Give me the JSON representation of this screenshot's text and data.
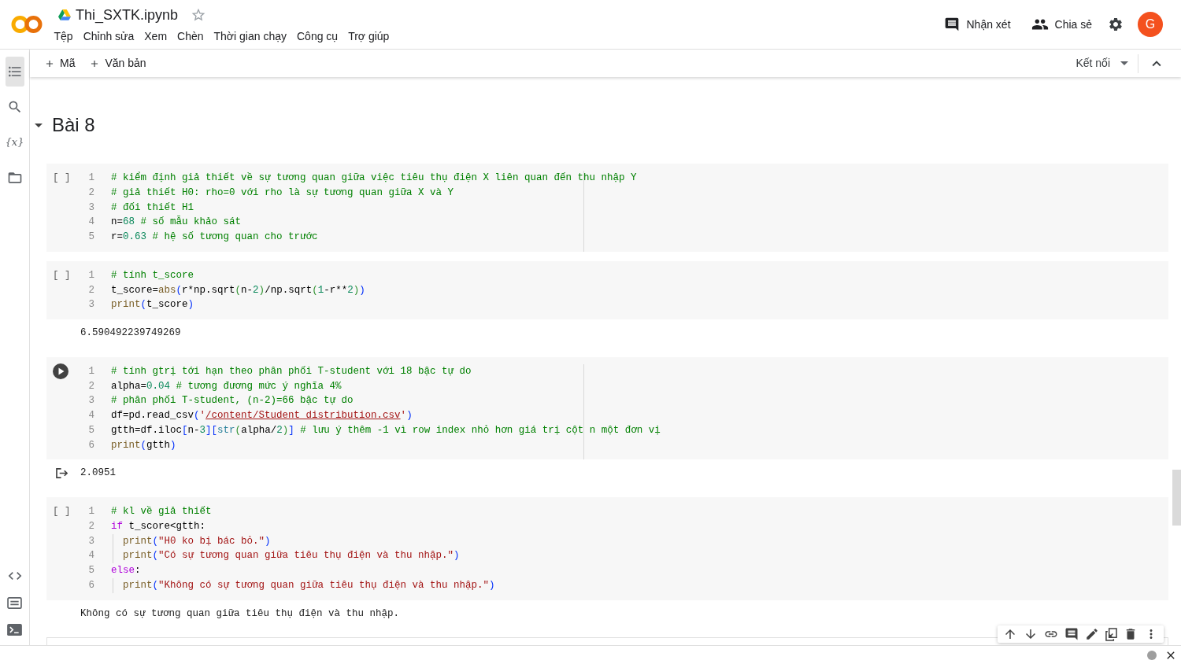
{
  "header": {
    "title": "Thi_SXTK.ipynb",
    "starred": false,
    "menu": [
      "Tệp",
      "Chỉnh sửa",
      "Xem",
      "Chèn",
      "Thời gian chạy",
      "Công cụ",
      "Trợ giúp"
    ],
    "actions": [
      {
        "kind": "comment",
        "label": "Nhận xét"
      },
      {
        "kind": "share",
        "label": "Chia sẻ"
      }
    ],
    "avatar": "G"
  },
  "sidebar": {
    "top": [
      {
        "kind": "toc",
        "selected": true
      },
      {
        "kind": "search",
        "selected": false
      },
      {
        "kind": "variables",
        "glyph": "{x}",
        "selected": false
      },
      {
        "kind": "files",
        "selected": false
      }
    ],
    "bottom": [
      {
        "kind": "snippets",
        "selected": false
      },
      {
        "kind": "palette",
        "selected": false
      },
      {
        "kind": "terminal",
        "selected": false
      }
    ]
  },
  "toolbar": {
    "add_buttons": [
      "Mã",
      "Văn bản"
    ],
    "connect": "Kết nối"
  },
  "section": {
    "title": "Bài 8",
    "expanded": true
  },
  "cells": [
    {
      "focused": false,
      "run_label": "[ ]",
      "ruler": true,
      "lines": [
        {
          "number": "1",
          "tokens": [
            {
              "kind": "comment",
              "text": "# kiểm định giả thiết về sự tương quan giữa việc tiêu thụ điện X liên quan đến thu nhập Y"
            }
          ]
        },
        {
          "number": "2",
          "tokens": [
            {
              "kind": "comment",
              "text": "# giả thiết H0: rho=0 với rho là sự tương quan giữa X và Y"
            }
          ]
        },
        {
          "number": "3",
          "tokens": [
            {
              "kind": "comment",
              "text": "# đối thiết H1"
            }
          ]
        },
        {
          "number": "4",
          "tokens": [
            {
              "kind": "plain",
              "text": "n="
            },
            {
              "kind": "number",
              "text": "68"
            },
            {
              "kind": "comment",
              "text": " # số mẫu khảo sát"
            }
          ]
        },
        {
          "number": "5",
          "tokens": [
            {
              "kind": "plain",
              "text": "r="
            },
            {
              "kind": "number",
              "text": "0.63"
            },
            {
              "kind": "comment",
              "text": " # hệ số tương quan cho trước"
            }
          ]
        }
      ]
    },
    {
      "focused": false,
      "run_label": "[ ]",
      "ruler": false,
      "lines": [
        {
          "number": "1",
          "tokens": [
            {
              "kind": "comment",
              "text": "# tính t_score"
            }
          ]
        },
        {
          "number": "2",
          "tokens": [
            {
              "kind": "plain",
              "text": "t_score="
            },
            {
              "kind": "function",
              "text": "abs"
            },
            {
              "kind": "bracket",
              "text": "("
            },
            {
              "kind": "plain",
              "text": "r*np.sqrt"
            },
            {
              "kind": "bracket2",
              "text": "("
            },
            {
              "kind": "plain",
              "text": "n-"
            },
            {
              "kind": "number",
              "text": "2"
            },
            {
              "kind": "bracket2",
              "text": ")"
            },
            {
              "kind": "plain",
              "text": "/np.sqrt"
            },
            {
              "kind": "bracket2",
              "text": "("
            },
            {
              "kind": "number",
              "text": "1"
            },
            {
              "kind": "plain",
              "text": "-r**"
            },
            {
              "kind": "number",
              "text": "2"
            },
            {
              "kind": "bracket2",
              "text": ")"
            },
            {
              "kind": "bracket",
              "text": ")"
            }
          ]
        },
        {
          "number": "3",
          "tokens": [
            {
              "kind": "function",
              "text": "print"
            },
            {
              "kind": "bracket",
              "text": "("
            },
            {
              "kind": "plain",
              "text": "t_score"
            },
            {
              "kind": "bracket",
              "text": ")"
            }
          ]
        }
      ],
      "output": {
        "text": "6.590492239749269",
        "clear_icon": false
      }
    },
    {
      "focused": true,
      "ruler": true,
      "lines": [
        {
          "number": "1",
          "tokens": [
            {
              "kind": "comment",
              "text": "# tính gtrị tới hạn theo phân phối T-student với 18 bậc tự do"
            }
          ]
        },
        {
          "number": "2",
          "tokens": [
            {
              "kind": "plain",
              "text": "alpha="
            },
            {
              "kind": "number",
              "text": "0.04"
            },
            {
              "kind": "comment",
              "text": " # tương đương mức ý nghĩa 4%"
            }
          ]
        },
        {
          "number": "3",
          "tokens": [
            {
              "kind": "comment",
              "text": "# phân phối T-student, (n-2)=66 bậc tự do"
            }
          ]
        },
        {
          "number": "4",
          "tokens": [
            {
              "kind": "plain",
              "text": "df=pd.read_csv"
            },
            {
              "kind": "bracket",
              "text": "("
            },
            {
              "kind": "string",
              "text": "'"
            },
            {
              "kind": "path",
              "text": "/content/Student_distribution.csv"
            },
            {
              "kind": "string",
              "text": "'"
            },
            {
              "kind": "bracket",
              "text": ")"
            }
          ]
        },
        {
          "number": "5",
          "tokens": [
            {
              "kind": "plain",
              "text": "gtth=df.iloc"
            },
            {
              "kind": "bracket",
              "text": "["
            },
            {
              "kind": "plain",
              "text": "n-"
            },
            {
              "kind": "number",
              "text": "3"
            },
            {
              "kind": "bracket",
              "text": "]"
            },
            {
              "kind": "bracket",
              "text": "["
            },
            {
              "kind": "builtin",
              "text": "str"
            },
            {
              "kind": "bracket2",
              "text": "("
            },
            {
              "kind": "plain",
              "text": "alpha/"
            },
            {
              "kind": "number",
              "text": "2"
            },
            {
              "kind": "bracket2",
              "text": ")"
            },
            {
              "kind": "bracket",
              "text": "]"
            },
            {
              "kind": "comment",
              "text": " # lưu ý thêm -1 vì row index nhỏ hơn giá trị cột n một đơn vị"
            }
          ]
        },
        {
          "number": "6",
          "tokens": [
            {
              "kind": "function",
              "text": "print"
            },
            {
              "kind": "bracket",
              "text": "("
            },
            {
              "kind": "plain",
              "text": "gtth"
            },
            {
              "kind": "bracket",
              "text": ")"
            }
          ]
        }
      ],
      "output": {
        "text": "2.0951",
        "clear_icon": true
      }
    },
    {
      "focused": false,
      "run_label": "[ ]",
      "ruler": false,
      "lines": [
        {
          "number": "1",
          "indented": false,
          "tokens": [
            {
              "kind": "comment",
              "text": "# kl về giả thiết"
            }
          ]
        },
        {
          "number": "2",
          "indented": false,
          "tokens": [
            {
              "kind": "keyword",
              "text": "if"
            },
            {
              "kind": "plain",
              "text": " t_score<gtth:"
            }
          ]
        },
        {
          "number": "3",
          "indented": true,
          "tokens": [
            {
              "kind": "function",
              "text": "print"
            },
            {
              "kind": "bracket",
              "text": "("
            },
            {
              "kind": "string",
              "text": "\"H0 ko bị bác bỏ.\""
            },
            {
              "kind": "bracket",
              "text": ")"
            }
          ]
        },
        {
          "number": "4",
          "indented": true,
          "tokens": [
            {
              "kind": "function",
              "text": "print"
            },
            {
              "kind": "bracket",
              "text": "("
            },
            {
              "kind": "string",
              "text": "\"Có sự tương quan giữa tiêu thụ điện và thu nhập.\""
            },
            {
              "kind": "bracket",
              "text": ")"
            }
          ]
        },
        {
          "number": "5",
          "indented": false,
          "tokens": [
            {
              "kind": "keyword",
              "text": "else"
            },
            {
              "kind": "plain",
              "text": ":"
            }
          ]
        },
        {
          "number": "6",
          "indented": true,
          "tokens": [
            {
              "kind": "function",
              "text": "print"
            },
            {
              "kind": "bracket",
              "text": "("
            },
            {
              "kind": "string",
              "text": "\"Không có sự tương quan giữa tiêu thụ điện và thu nhập.\""
            },
            {
              "kind": "bracket",
              "text": ")"
            }
          ]
        }
      ],
      "output": {
        "text": "Không có sự tương quan giữa tiêu thụ điện và thu nhập.",
        "clear_icon": false
      }
    }
  ]
}
